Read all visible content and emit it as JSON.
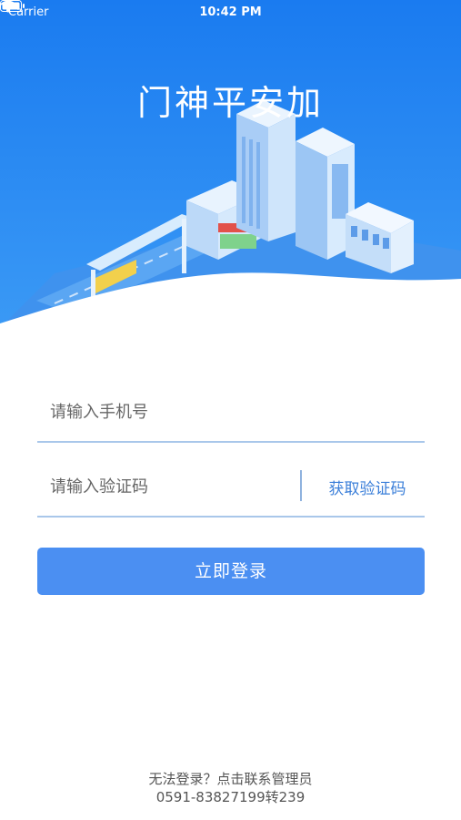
{
  "status_bar": {
    "carrier": "Carrier",
    "time": "10:42 PM"
  },
  "app": {
    "title": "门神平安加"
  },
  "form": {
    "phone_placeholder": "请输入手机号",
    "code_placeholder": "请输入验证码",
    "get_code_label": "获取验证码",
    "login_label": "立即登录"
  },
  "footer": {
    "help_text": "无法登录？点击联系管理员",
    "phone": "0591-83827199转239"
  },
  "colors": {
    "primary": "#4b8ff2",
    "hero_blue": "#1d7df0",
    "link": "#3b7fd9",
    "underline": "#a9c7ea"
  }
}
